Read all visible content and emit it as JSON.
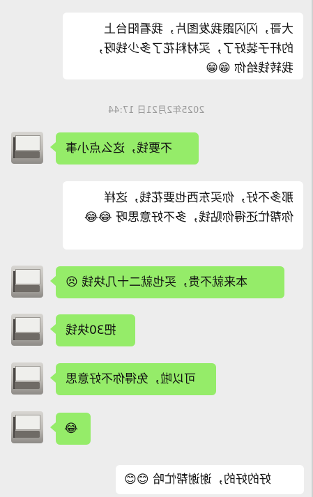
{
  "chat": {
    "timestamp": "2025年2月21日 17:44",
    "messages": [
      {
        "side": "white",
        "text": "大哥，闪闪跟我发图片，我看阳台上\n的杆子装好了，买材料花了多少钱呀，\n我转钱给你",
        "emoji": "😁😁"
      },
      {
        "side": "green",
        "text": "不要钱，这么点小事"
      },
      {
        "side": "white",
        "text": "那多不好，你买东西也要花钱，这样\n你帮忙还得你贴钱，多不好意思呀",
        "emoji": "😂😂"
      },
      {
        "side": "green",
        "text": "本来就不贵，买也就二十几块钱",
        "emoji": "😣"
      },
      {
        "side": "green",
        "text": "把30块钱"
      },
      {
        "side": "green",
        "text": "可以啦，免得你不好意思"
      },
      {
        "side": "green",
        "text": "",
        "emoji": "😂"
      },
      {
        "side": "white",
        "text": "好的好的，谢谢帮忙哈",
        "emoji": "😊😊"
      }
    ]
  }
}
